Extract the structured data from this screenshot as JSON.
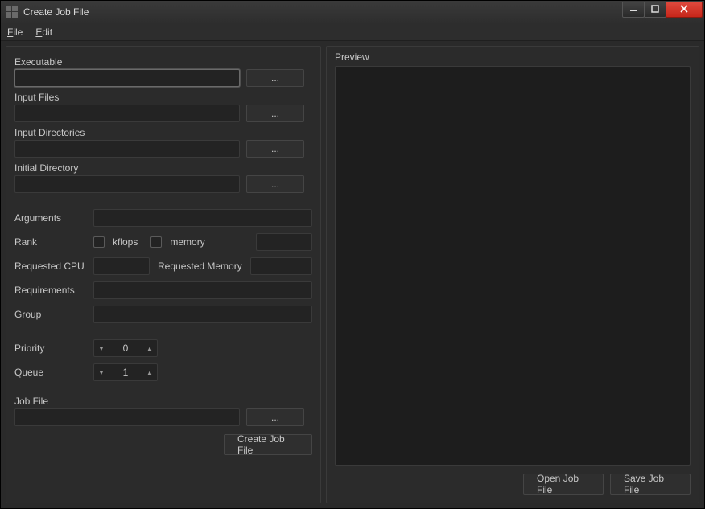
{
  "window": {
    "title": "Create Job File"
  },
  "menu": {
    "file": "File",
    "edit": "Edit"
  },
  "left": {
    "executable_label": "Executable",
    "input_files_label": "Input Files",
    "input_dirs_label": "Input Directories",
    "initial_dir_label": "Initial Directory",
    "browse_label": "...",
    "arguments_label": "Arguments",
    "rank_label": "Rank",
    "kflops_label": "kflops",
    "memory_label": "memory",
    "req_cpu_label": "Requested CPU",
    "req_mem_label": "Requested Memory",
    "requirements_label": "Requirements",
    "group_label": "Group",
    "priority_label": "Priority",
    "priority_value": "0",
    "queue_label": "Queue",
    "queue_value": "1",
    "job_file_label": "Job File",
    "create_button": "Create Job File",
    "executable_value": "",
    "input_files_value": "",
    "input_dirs_value": "",
    "initial_dir_value": "",
    "arguments_value": "",
    "rank_value": "",
    "req_cpu_value": "",
    "req_mem_value": "",
    "requirements_value": "",
    "group_value": "",
    "job_file_value": ""
  },
  "right": {
    "preview_label": "Preview",
    "open_button": "Open Job File",
    "save_button": "Save Job File"
  }
}
